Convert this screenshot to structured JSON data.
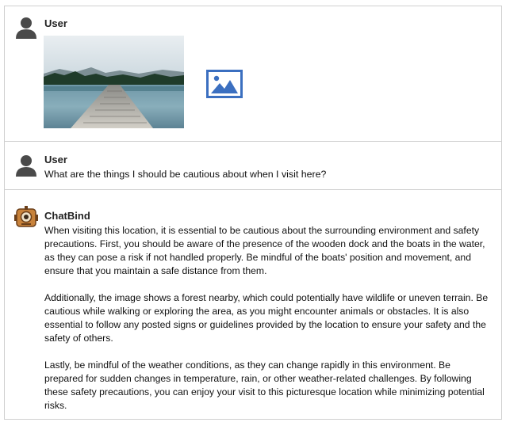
{
  "messages": [
    {
      "sender": "User"
    },
    {
      "sender": "User",
      "text": "What are the things I should be cautious about when I visit here?"
    },
    {
      "sender": "ChatBind",
      "paragraphs": [
        "When visiting this location, it is essential to be cautious about the surrounding environment and safety precautions. First, you should be aware of the presence of the wooden dock and the boats in the water, as they can pose a risk if not handled properly. Be mindful of the boats' position and movement, and ensure that you maintain a safe distance from them.",
        "Additionally, the image shows a forest nearby, which could potentially have wildlife or uneven terrain. Be cautious while walking or exploring the area, as you might encounter animals or obstacles. It is also essential to follow any posted signs or guidelines provided by the location to ensure your safety and the safety of others.",
        "Lastly, be mindful of the weather conditions, as they can change rapidly in this environment. Be prepared for sudden changes in temperature, rain, or other weather-related challenges. By following these safety precautions, you can enjoy your visit to this picturesque location while minimizing potential risks."
      ]
    }
  ],
  "icons": {
    "user_avatar": "user-avatar-icon",
    "bot_avatar": "robot-avatar-icon",
    "image_placeholder": "image-icon"
  },
  "colors": {
    "image_icon": "#3b6fc0",
    "avatar": "#4a4a4a",
    "border": "#cfcfcf"
  }
}
